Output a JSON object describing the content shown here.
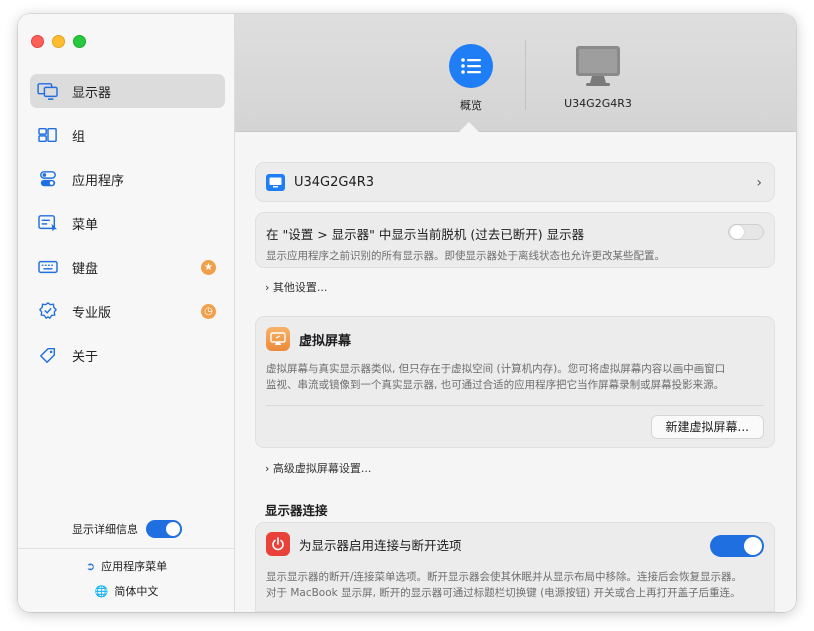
{
  "sidebar": {
    "items": [
      {
        "label": "显示器",
        "icon": "display-icon",
        "active": true
      },
      {
        "label": "组",
        "icon": "group-icon"
      },
      {
        "label": "应用程序",
        "icon": "app-icon"
      },
      {
        "label": "菜单",
        "icon": "menu-icon"
      },
      {
        "label": "键盘",
        "icon": "keyboard-icon",
        "badge": "accessibility-icon"
      },
      {
        "label": "专业版",
        "icon": "pro-badge-icon",
        "badge": "clock-icon"
      },
      {
        "label": "关于",
        "icon": "tag-icon"
      }
    ],
    "show_details_label": "显示详细信息",
    "app_menu_label": "应用程序菜单",
    "language_label": "简体中文"
  },
  "tabs": [
    {
      "label": "概览",
      "icon": "list-icon",
      "active": true
    },
    {
      "label": "U34G2G4R3",
      "icon": "monitor-icon"
    }
  ],
  "main": {
    "monitor_row": {
      "name": "U34G2G4R3"
    },
    "offline_card": {
      "title": "在 \"设置 > 显示器\" 中显示当前脱机 (过去已断开) 显示器",
      "desc": "显示应用程序之前识别的所有显示器。即使显示器处于离线状态也允许更改某些配置。",
      "toggle_on": false
    },
    "other_settings": "其他设置...",
    "virtual_card": {
      "title": "虚拟屏幕",
      "desc_line1": "虚拟屏幕与真实显示器类似, 但只存在于虚拟空间 (计算机内存)。您可将虚拟屏幕内容以画中画窗口",
      "desc_line2": "监视、串流或镜像到一个真实显示器, 也可通过合适的应用程序把它当作屏幕录制或屏幕投影来源。",
      "button": "新建虚拟屏幕..."
    },
    "advanced_virtual": "高级虚拟屏幕设置...",
    "connection_section": "显示器连接",
    "connection_card": {
      "title": "为显示器启用连接与断开选项",
      "desc_line1": "显示显示器的断开/连接菜单选项。断开显示器会使其休眠并从显示布局中移除。连接后会恢复显示器。",
      "desc_line2": "对于 MacBook 显示屏, 断开的显示器可通过标题栏切换键 (电源按钮) 开关或合上再打开盖子后重连。",
      "toggle_on": true
    }
  },
  "colors": {
    "accent": "#1f6fe0",
    "tab_active": "#1f7ef5",
    "badge": "#f0a04b",
    "virtual_icon": "#ec8a3a",
    "power_icon": "#e8423b"
  }
}
